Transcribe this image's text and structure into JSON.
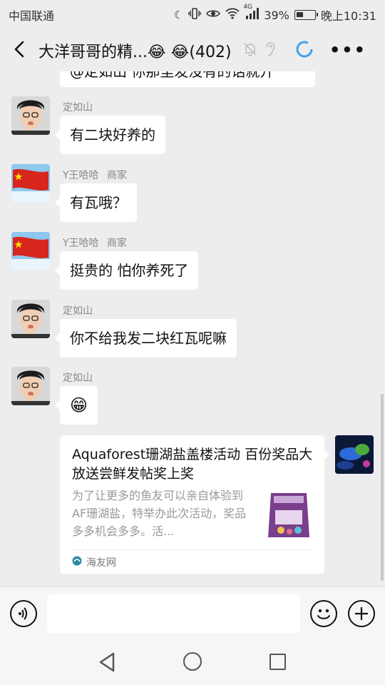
{
  "status_bar": {
    "carrier": "中国联通",
    "network": "4G",
    "battery": "39%",
    "battery_level": 0.39,
    "time": "晚上10:31",
    "icons": [
      "moon-icon",
      "vibrate-icon",
      "eye-icon",
      "wifi-icon",
      "signal-icon",
      "battery-icon"
    ]
  },
  "title_bar": {
    "title": "大洋哥哥的精...😂 😂(402)",
    "icons": [
      "back-icon",
      "mute-bell-icon",
      "ear-icon",
      "loading-ring-icon",
      "more-icon"
    ]
  },
  "partial_message": "@定如山 你那里发没有的话就开",
  "messages": [
    {
      "sender": "定如山",
      "tag": "",
      "avatar": "man-avatar",
      "text": "有二块好养的"
    },
    {
      "sender": "Y王哈哈",
      "tag": "商家",
      "avatar": "flag-avatar",
      "text": "有瓦哦？"
    },
    {
      "sender": "Y王哈哈",
      "tag": "商家",
      "avatar": "flag-avatar",
      "text": "挺贵的 怕你养死了"
    },
    {
      "sender": "定如山",
      "tag": "",
      "avatar": "man-avatar",
      "text": "你不给我发二块红瓦呢嘛"
    },
    {
      "sender": "定如山",
      "tag": "",
      "avatar": "man-avatar",
      "text": "😁"
    }
  ],
  "link_card": {
    "title": "Aquaforest珊湖盐盖楼活动 百份奖品大放送尝鲜发帖奖上奖",
    "description": "为了让更多的鱼友可以亲自体验到AF珊湖盐，特举办此次活动，奖品多多机会多多。活...",
    "source": "海友网"
  },
  "input_bar": {
    "placeholder": "",
    "icons": [
      "voice-icon",
      "emoji-icon",
      "plus-icon"
    ]
  },
  "nav_bar": {
    "icons": [
      "nav-back-icon",
      "nav-home-icon",
      "nav-recent-icon"
    ]
  }
}
